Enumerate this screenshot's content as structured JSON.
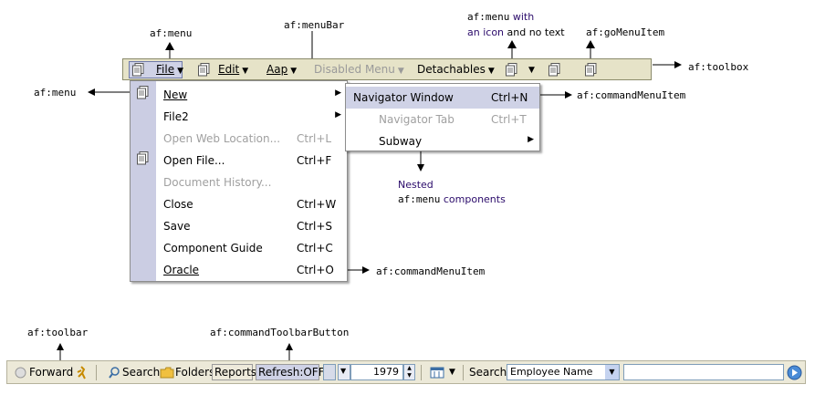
{
  "annotations": {
    "menu_top": "af:menu",
    "menubar": "af:menuBar",
    "menu_icon_prefix": "af:menu",
    "menu_icon_with": "with",
    "menu_icon_line2_a": "an icon",
    "menu_icon_line2_b": "and no text",
    "gomenuitem": "af:goMenuItem",
    "toolbox": "af:toolbox",
    "menu_left": "af:menu",
    "commandmenuitem_1": "af:commandMenuItem",
    "nested_1": "Nested",
    "nested_2_code": "af:menu",
    "nested_2_text": "components",
    "commandmenuitem_2": "af:commandMenuItem",
    "toolbar": "af:toolbar",
    "commandtoolbarbutton": "af:commandToolbarButton"
  },
  "menubar": {
    "file": "File",
    "edit": "Edit",
    "aap": "Aap",
    "disabled_menu": "Disabled Menu",
    "detachables": "Detachables"
  },
  "file_menu": {
    "items": [
      {
        "label": "New",
        "accel": "",
        "submenu": true,
        "disabled": false
      },
      {
        "label": "File2",
        "accel": "",
        "submenu": true,
        "disabled": false
      },
      {
        "label": "Open Web Location...",
        "accel": "Ctrl+L",
        "submenu": false,
        "disabled": true
      },
      {
        "label": "Open File...",
        "accel": "Ctrl+F",
        "submenu": false,
        "disabled": false
      },
      {
        "label": "Document History...",
        "accel": "",
        "submenu": false,
        "disabled": true
      },
      {
        "label": "Close",
        "accel": "Ctrl+W",
        "submenu": false,
        "disabled": false
      },
      {
        "label": "Save",
        "accel": "Ctrl+S",
        "submenu": false,
        "disabled": false
      },
      {
        "label": "Component Guide",
        "accel": "Ctrl+C",
        "submenu": false,
        "disabled": false
      },
      {
        "label": "Oracle",
        "accel": "Ctrl+O",
        "submenu": false,
        "disabled": false
      }
    ]
  },
  "new_submenu": {
    "items": [
      {
        "label": "Navigator Window",
        "accel": "Ctrl+N",
        "disabled": false
      },
      {
        "label": "Navigator Tab",
        "accel": "Ctrl+T",
        "disabled": true
      },
      {
        "label": "Subway",
        "accel": "",
        "disabled": false
      }
    ]
  },
  "toolbar": {
    "forward": "Forward",
    "search": "Search",
    "folders": "Folders",
    "reports": "Reports",
    "refresh": "Refresh:OFF",
    "year_value": "1979",
    "search_label": "Search",
    "search_select_value": "Employee Name",
    "search_text_value": ""
  },
  "colors": {
    "menubar_bg": "#e6e3c8",
    "menu_gutter": "#cbcde3",
    "menu_highlight": "#cfd2e6",
    "toolbar_bg": "#ece9d8",
    "annotation_purple": "#2a0a6a"
  }
}
